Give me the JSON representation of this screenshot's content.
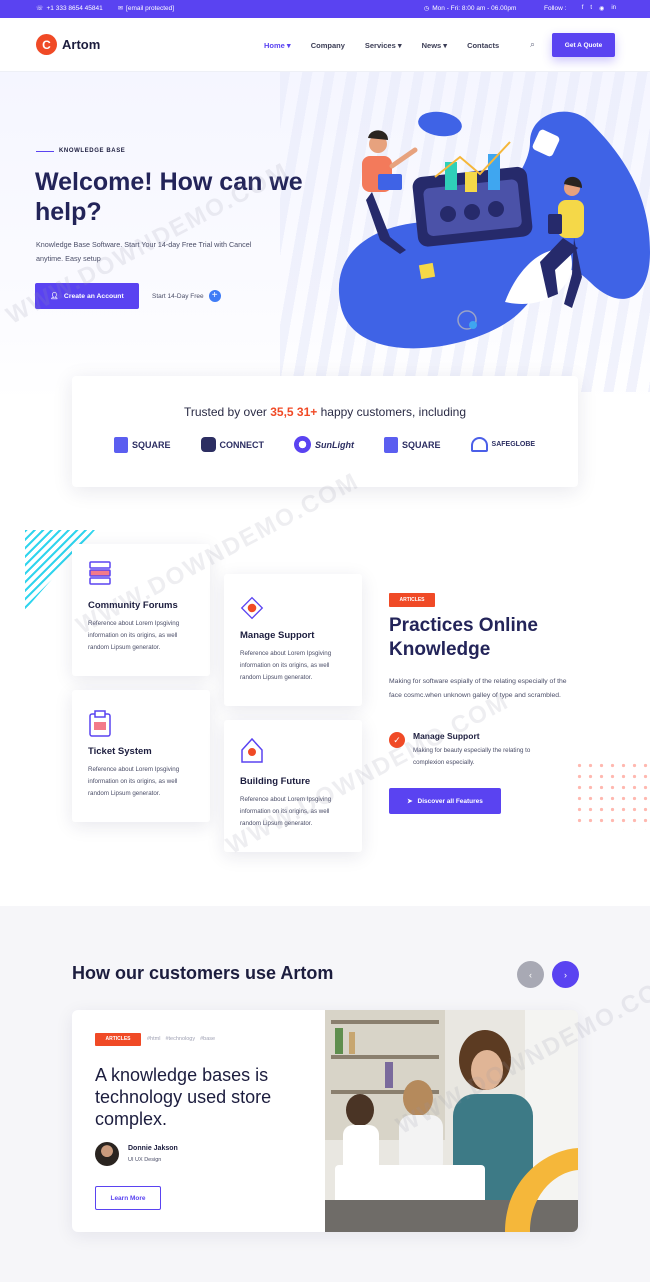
{
  "topbar": {
    "phone": "+1 333 8654 45841",
    "email": "[email protected]",
    "hours": "Mon - Fri: 8:00 am - 06.00pm",
    "follow_label": "Follow :",
    "social": [
      "f",
      "t",
      "◉",
      "in"
    ]
  },
  "header": {
    "logo_letter": "C",
    "logo_text": "Artom",
    "nav": [
      "Home",
      "Company",
      "Services",
      "News",
      "Contacts"
    ],
    "quote_button": "Get A Quote"
  },
  "hero": {
    "eyebrow": "KNOWLEDGE BASE",
    "title": "Welcome! How can we help?",
    "description": "Knowledge Base Software. Start Your 14-day Free Trial with Cancel anytime. Easy setup",
    "primary_button": "Create an Account",
    "trial_link": "Start 14-Day Free"
  },
  "trust": {
    "prefix": "Trusted by over",
    "highlight": "35,5 31+",
    "suffix": "happy customers, including",
    "logos": [
      "SQUARE",
      "CONNECT",
      "SunLight",
      "SQUARE",
      "SAFEGLOBE"
    ]
  },
  "features": [
    {
      "title": "Community Forums",
      "desc": "Reference about Lorem Ipsgiving information on its origins, as well random Lipsum generator."
    },
    {
      "title": "Manage Support",
      "desc": "Reference about Lorem Ipsgiving information on its origins, as well random Lipsum generator."
    },
    {
      "title": "Ticket System",
      "desc": "Reference about Lorem Ipsgiving information on its origins, as well random Lipsum generator."
    },
    {
      "title": "Building Future",
      "desc": "Reference about Lorem Ipsgiving information on its origins, as well random Lipsum generator."
    }
  ],
  "article": {
    "badge": "ARTICLES",
    "title": "Practices Online Knowledge",
    "description": "Making for software espially of the relating especially of the face cosmc.when unknown galley of type and scrambled.",
    "point_title": "Manage Support",
    "point_desc": "Making for beauty especially the relating to complexion especially.",
    "button": "Discover all Features"
  },
  "customers": {
    "title": "How our customers use Artom",
    "badge": "ARTICLES",
    "tags": [
      "#html",
      "#technology",
      "#base"
    ],
    "story_title": "A knowledge bases is technology used store complex.",
    "author_name": "Donnie Jakson",
    "author_role": "UI UX Design",
    "button": "Learn More"
  },
  "watermark": "WWW.DOWNDEMO.COM",
  "colors": {
    "primary": "#5a43f1",
    "accent": "#f04a26",
    "dark": "#1c1d3e"
  }
}
